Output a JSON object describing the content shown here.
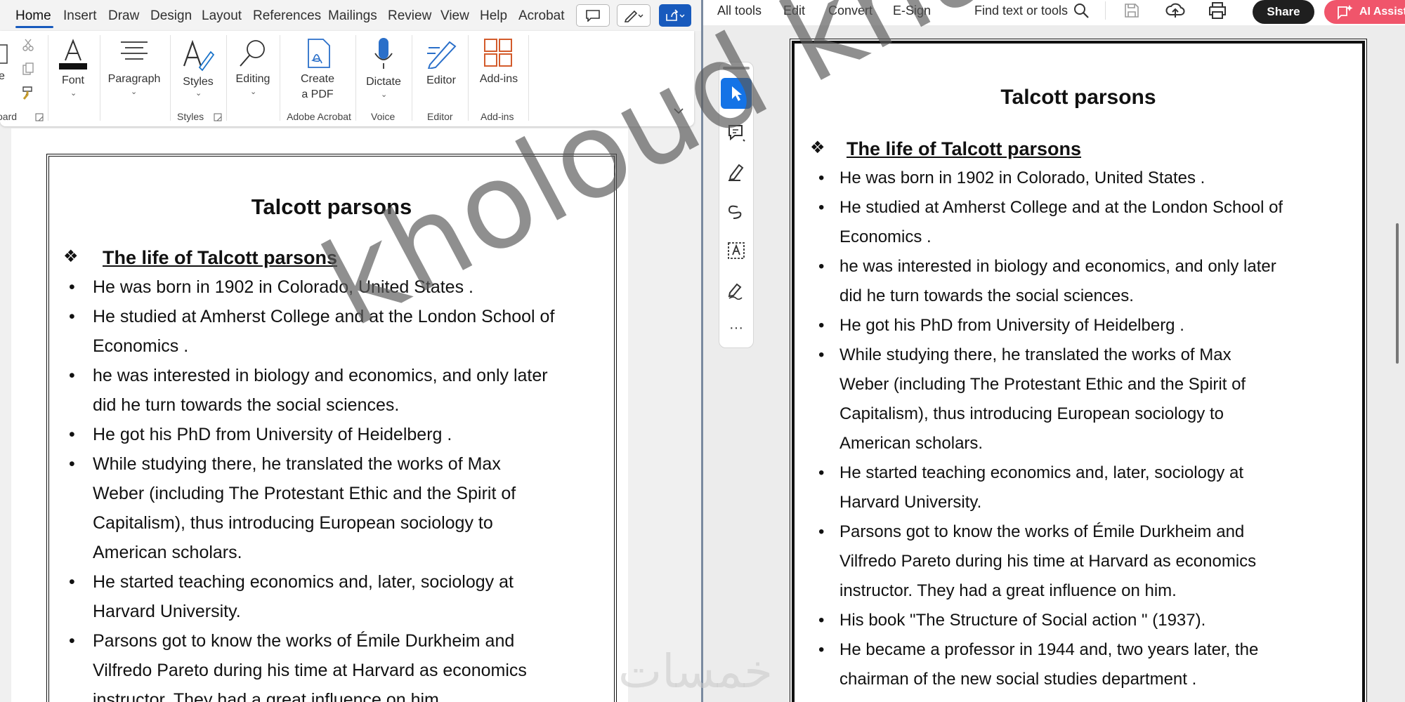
{
  "word": {
    "tabs": [
      "Home",
      "Insert",
      "Draw",
      "Design",
      "Layout",
      "References",
      "Mailings",
      "Review",
      "View",
      "Help",
      "Acrobat"
    ],
    "ribbon": {
      "clipboard_partial_label": "e",
      "clipboard_group": "oard",
      "font_label": "Font",
      "paragraph_label": "Paragraph",
      "styles_label": "Styles",
      "styles_group": "Styles",
      "editing_label": "Editing",
      "create_pdf_line1": "Create",
      "create_pdf_line2": "a PDF",
      "adobe_group": "Adobe Acrobat",
      "dictate_label": "Dictate",
      "voice_group": "Voice",
      "editor_label": "Editor",
      "editor_group": "Editor",
      "addins_label": "Add-ins",
      "addins_group": "Add-ins"
    },
    "document": {
      "title": "Talcott parsons",
      "heading": "The life of Talcott parsons",
      "bullets": [
        [
          "He was born in 1902 in Colorado, United States ."
        ],
        [
          "He studied at Amherst College and at the London School of",
          "Economics ."
        ],
        [
          " he was interested in biology and economics, and only later",
          "did he turn towards the social sciences."
        ],
        [
          "He got his PhD from University of Heidelberg ."
        ],
        [
          "While studying there, he translated the works of Max",
          "Weber (including The Protestant Ethic and the Spirit of",
          "Capitalism), thus introducing European sociology to",
          "American scholars."
        ],
        [
          "He started teaching economics and, later, sociology at",
          "Harvard University."
        ],
        [
          "Parsons got to know the works of Émile Durkheim and",
          "Vilfredo Pareto during his time at Harvard as economics",
          "instructor. They had a great influence on him."
        ]
      ]
    }
  },
  "acrobat": {
    "toolbar": {
      "all_tools": "All tools",
      "edit": "Edit",
      "convert": "Convert",
      "esign": "E-Sign",
      "find": "Find text or tools",
      "share": "Share",
      "ai": "AI Assist"
    },
    "document": {
      "title": "Talcott parsons",
      "heading": "The life of Talcott parsons",
      "bullets": [
        [
          "He was born in 1902 in Colorado, United States ."
        ],
        [
          "He studied at Amherst College and at the London School of",
          "Economics ."
        ],
        [
          " he was interested in biology and economics, and only later",
          "did he turn towards the social sciences."
        ],
        [
          "He got his PhD from University of Heidelberg ."
        ],
        [
          "While studying there, he translated the works of Max",
          "Weber (including The Protestant Ethic and the Spirit of",
          "Capitalism), thus introducing European sociology to",
          "American scholars."
        ],
        [
          "He started teaching economics and, later, sociology at",
          "Harvard University."
        ],
        [
          "Parsons got to know the works of Émile Durkheim and",
          "Vilfredo Pareto during his time at Harvard as economics",
          "instructor. They had a great influence on him."
        ],
        [
          "His book \"The Structure of Social action \" (1937)."
        ],
        [
          "He became a professor in 1944 and, two years later, the",
          "chairman of the new social studies department ."
        ]
      ]
    }
  },
  "watermark": "kholoud khaled",
  "site_watermark": "خمسات",
  "colors": {
    "word_accent": "#185abd",
    "acrobat_select": "#1473e6",
    "ai_button": "#f0556b"
  }
}
